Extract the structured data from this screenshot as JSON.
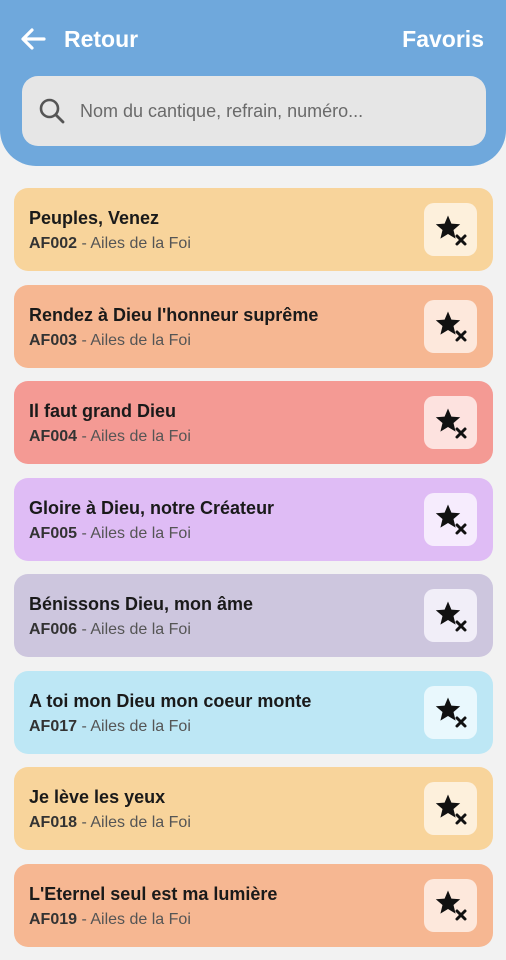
{
  "header": {
    "back_label": "Retour",
    "favorites_label": "Favoris",
    "background_color": "#6fa8dc"
  },
  "search": {
    "placeholder": "Nom du cantique, refrain, numéro...",
    "value": ""
  },
  "songs": [
    {
      "title": "Peuples, Venez",
      "code": "AF002",
      "collection": "Ailes de la Foi",
      "color": "#f8d49b",
      "button_color": "#fdf0dc",
      "icon": "star-remove-icon"
    },
    {
      "title": "Rendez à Dieu l'honneur suprême",
      "code": "AF003",
      "collection": "Ailes de la Foi",
      "color": "#f6b792",
      "button_color": "#fde8dc",
      "icon": "star-remove-icon"
    },
    {
      "title": "Il faut grand Dieu",
      "code": "AF004",
      "collection": "Ailes de la Foi",
      "color": "#f49a94",
      "button_color": "#fde2df",
      "icon": "star-remove-icon"
    },
    {
      "title": "Gloire à Dieu, notre Créateur",
      "code": "AF005",
      "collection": "Ailes de la Foi",
      "color": "#dfbcf5",
      "button_color": "#f6ecfd",
      "icon": "star-remove-icon"
    },
    {
      "title": "Bénissons Dieu, mon âme",
      "code": "AF006",
      "collection": "Ailes de la Foi",
      "color": "#cdc6de",
      "button_color": "#f1eef8",
      "icon": "star-remove-icon"
    },
    {
      "title": "A toi mon Dieu mon coeur monte",
      "code": "AF017",
      "collection": "Ailes de la Foi",
      "color": "#bde7f5",
      "button_color": "#e9f8fd",
      "icon": "star-remove-icon"
    },
    {
      "title": "Je lève les yeux",
      "code": "AF018",
      "collection": "Ailes de la Foi",
      "color": "#f8d49b",
      "button_color": "#fdf0dc",
      "icon": "star-remove-icon"
    },
    {
      "title": "L'Eternel seul est ma lumière",
      "code": "AF019",
      "collection": "Ailes de la Foi",
      "color": "#f6b792",
      "button_color": "#fde8dc",
      "icon": "star-remove-icon"
    }
  ]
}
